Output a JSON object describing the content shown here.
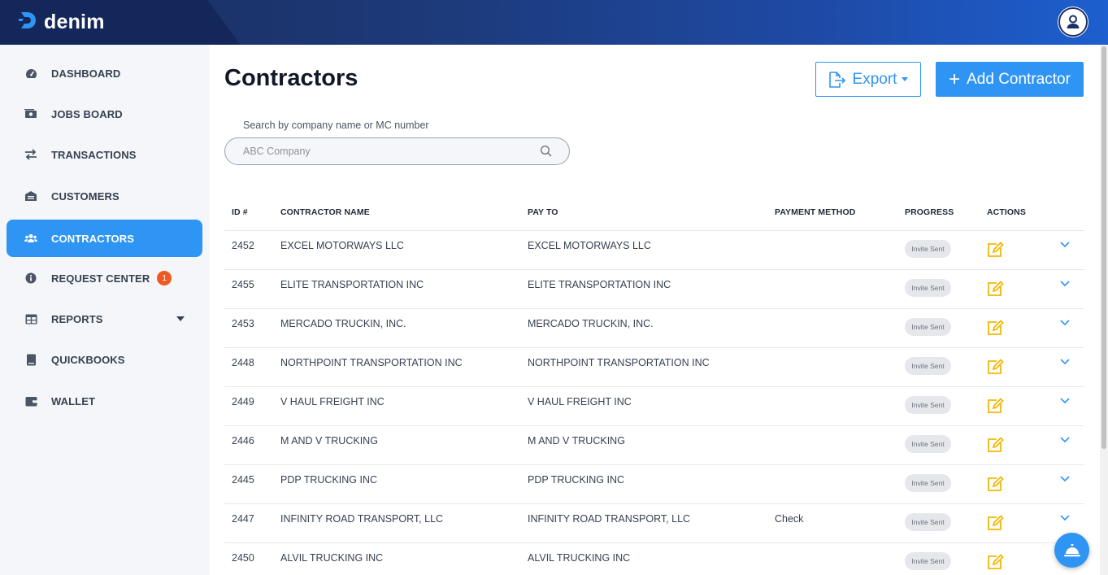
{
  "app": {
    "brand": "denim"
  },
  "sidebar": {
    "items": [
      {
        "label": "DASHBOARD",
        "icon": "speedometer-icon"
      },
      {
        "label": "JOBS BOARD",
        "icon": "money-icon"
      },
      {
        "label": "TRANSACTIONS",
        "icon": "exchange-arrows-icon"
      },
      {
        "label": "CUSTOMERS",
        "icon": "warehouse-icon"
      },
      {
        "label": "CONTRACTORS",
        "icon": "users-icon",
        "active": true
      },
      {
        "label": "REQUEST CENTER",
        "icon": "info-icon",
        "badge": "1"
      },
      {
        "label": "REPORTS",
        "icon": "table-icon",
        "has_dropdown": true
      },
      {
        "label": "QUICKBOOKS",
        "icon": "book-icon"
      },
      {
        "label": "WALLET",
        "icon": "wallet-icon"
      }
    ]
  },
  "main": {
    "title": "Contractors",
    "export_label": "Export",
    "add_label": "Add Contractor",
    "search": {
      "label": "Search by company name or MC number",
      "placeholder": "ABC Company"
    }
  },
  "table": {
    "headers": [
      "ID #",
      "CONTRACTOR NAME",
      "PAY TO",
      "PAYMENT METHOD",
      "PROGRESS",
      "ACTIONS"
    ],
    "rows": [
      {
        "id": "2452",
        "name": "EXCEL MOTORWAYS LLC",
        "pay_to": "EXCEL MOTORWAYS LLC",
        "method": "",
        "progress": "Invite Sent"
      },
      {
        "id": "2455",
        "name": "ELITE TRANSPORTATION INC",
        "pay_to": "ELITE TRANSPORTATION INC",
        "method": "",
        "progress": "Invite Sent"
      },
      {
        "id": "2453",
        "name": "MERCADO TRUCKIN, INC.",
        "pay_to": "MERCADO TRUCKIN, INC.",
        "method": "",
        "progress": "Invite Sent"
      },
      {
        "id": "2448",
        "name": "NORTHPOINT TRANSPORTATION INC",
        "pay_to": "NORTHPOINT TRANSPORTATION INC",
        "method": "",
        "progress": "Invite Sent"
      },
      {
        "id": "2449",
        "name": "V HAUL FREIGHT INC",
        "pay_to": "V HAUL FREIGHT INC",
        "method": "",
        "progress": "Invite Sent"
      },
      {
        "id": "2446",
        "name": "M AND V TRUCKING",
        "pay_to": "M AND V TRUCKING",
        "method": "",
        "progress": "Invite Sent"
      },
      {
        "id": "2445",
        "name": "PDP TRUCKING INC",
        "pay_to": "PDP TRUCKING INC",
        "method": "",
        "progress": "Invite Sent"
      },
      {
        "id": "2447",
        "name": "INFINITY ROAD TRANSPORT, LLC",
        "pay_to": "INFINITY ROAD TRANSPORT, LLC",
        "method": "Check",
        "progress": "Invite Sent"
      },
      {
        "id": "2450",
        "name": "ALVIL TRUCKING INC",
        "pay_to": "ALVIL TRUCKING INC",
        "method": "",
        "progress": "Invite Sent"
      }
    ]
  },
  "colors": {
    "primary": "#2f95f5",
    "badge": "#f05a22",
    "edit_icon": "#f2b705",
    "sidebar_bg": "#f4f6f9"
  }
}
